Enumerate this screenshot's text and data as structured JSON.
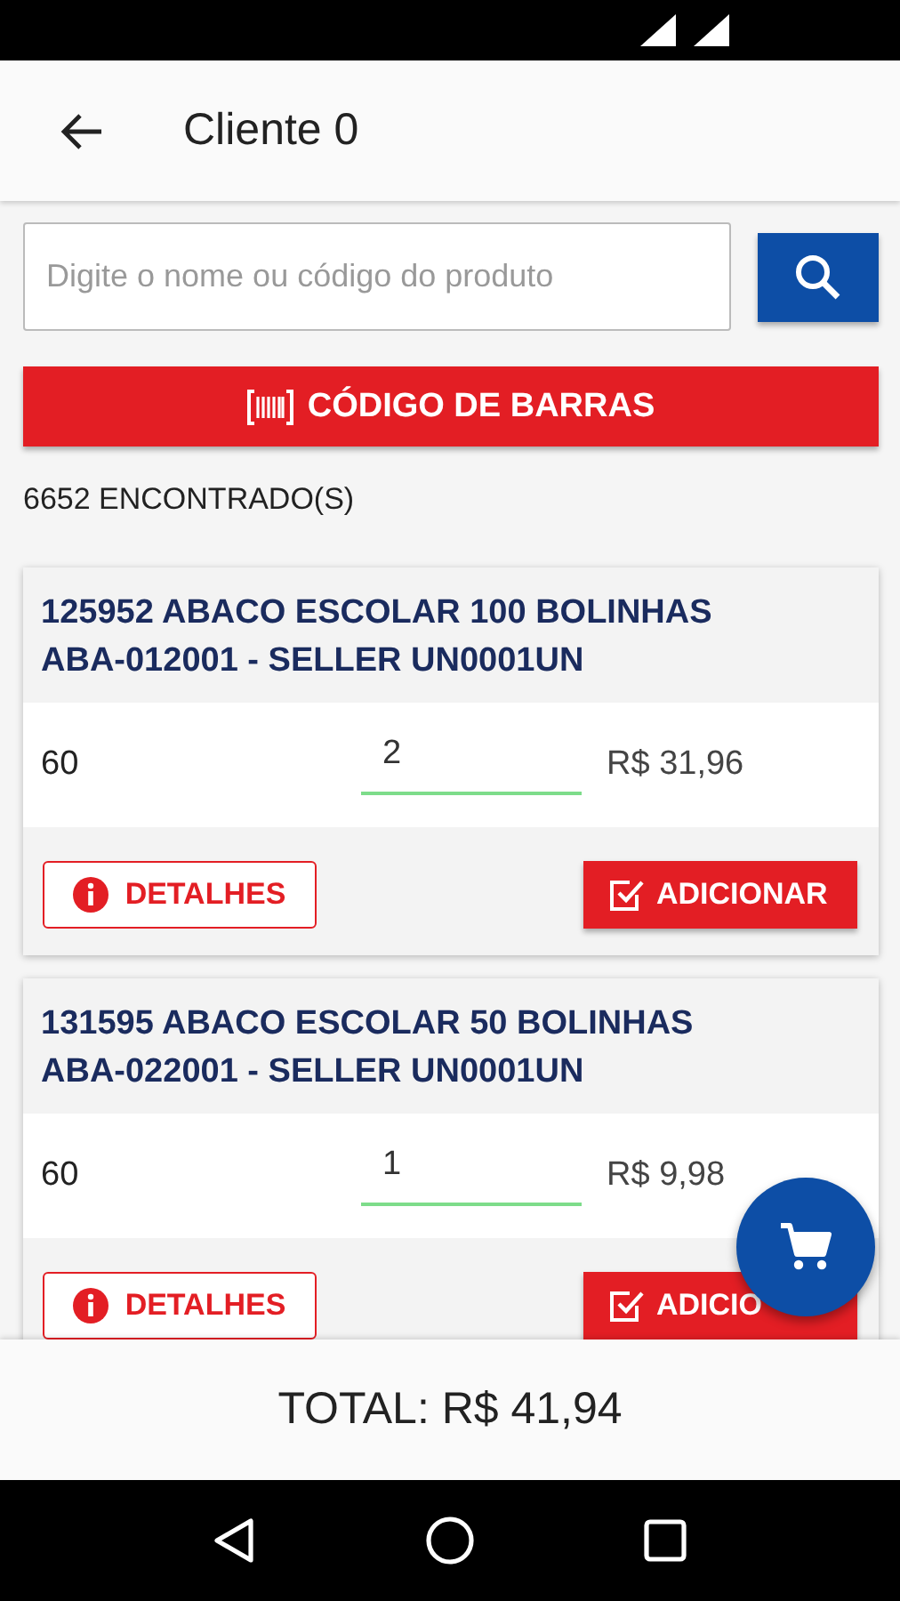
{
  "header": {
    "title": "Cliente 0"
  },
  "search": {
    "placeholder": "Digite o nome ou código do produto"
  },
  "barcode_button": {
    "label": "CÓDIGO DE BARRAS"
  },
  "result_count": "6652 ENCONTRADO(S)",
  "products": [
    {
      "name": "125952 ABACO ESCOLAR 100 BOLINHAS",
      "code": "ABA-012001 - SELLER UN0001UN",
      "stock": "60",
      "quantity": "2",
      "price": "R$ 31,96",
      "details_label": "DETALHES",
      "add_label": "ADICIONAR"
    },
    {
      "name": "131595 ABACO ESCOLAR 50 BOLINHAS",
      "code": "ABA-022001 - SELLER UN0001UN",
      "stock": "60",
      "quantity": "1",
      "price": "R$ 9,98",
      "details_label": "DETALHES",
      "add_label": "ADICIO"
    }
  ],
  "total": "TOTAL: R$ 41,94"
}
